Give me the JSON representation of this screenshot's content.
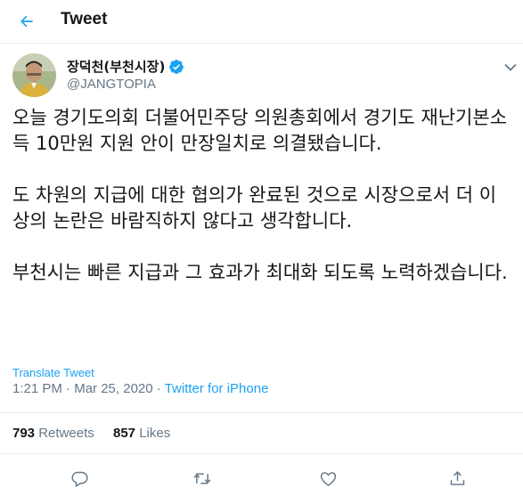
{
  "header": {
    "title": "Tweet"
  },
  "author": {
    "display_name": "장덕천(부천시장)",
    "handle": "@JANGTOPIA"
  },
  "tweet": {
    "paragraphs": [
      "오늘 경기도의회 더불어민주당 의원총회에서 경기도 재난기본소득 10만원 지원 안이 만장일치로 의결됐습니다.",
      "도 차원의 지급에 대한 협의가 완료된 것으로 시장으로서 더 이상의 논란은 바람직하지 않다고 생각합니다.",
      "부천시는 빠른 지급과 그 효과가 최대화 되도록 노력하겠습니다."
    ],
    "translate_label": "Translate Tweet",
    "time": "1:21 PM",
    "separator": "·",
    "date": "Mar 25, 2020",
    "source": "Twitter for iPhone"
  },
  "stats": {
    "retweets_count": "793",
    "retweets_label": "Retweets",
    "likes_count": "857",
    "likes_label": "Likes"
  },
  "colors": {
    "accent": "#1da1f2",
    "secondary_text": "#657786",
    "divider": "#e6ecf0"
  },
  "icons": [
    "back-arrow-icon",
    "verified-badge-icon",
    "chevron-down-icon",
    "reply-icon",
    "retweet-icon",
    "like-icon",
    "share-icon"
  ]
}
